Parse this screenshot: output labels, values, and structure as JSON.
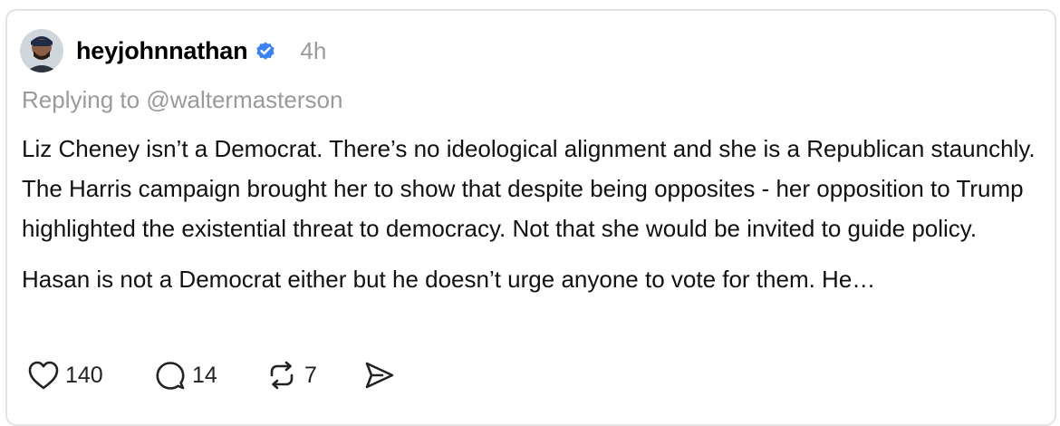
{
  "post": {
    "author": {
      "username": "heyjohnnathan",
      "verified_icon": "verified-badge-icon",
      "avatar": "avatar"
    },
    "timestamp": "4h",
    "reply_prefix": "Replying to ",
    "reply_handle": "@waltermasterson",
    "paragraphs": [
      "Liz Cheney isn’t a Democrat. There’s no ideological alignment and she is a Republican staunchly. The Harris campaign brought her to show that despite being opposites - her opposition to Trump highlighted the existential threat to democracy. Not that she would be invited to guide policy.",
      "Hasan is not a Democrat either but he doesn’t urge anyone to vote for them. He…"
    ],
    "actions": {
      "like": {
        "icon": "heart-icon",
        "count": "140"
      },
      "reply": {
        "icon": "comment-icon",
        "count": "14"
      },
      "repost": {
        "icon": "repost-icon",
        "count": "7"
      },
      "share": {
        "icon": "send-icon"
      }
    }
  },
  "colors": {
    "verified": "#3b82f6",
    "muted": "#9a9a9a",
    "border": "#e3e3e3",
    "text": "#111111"
  }
}
